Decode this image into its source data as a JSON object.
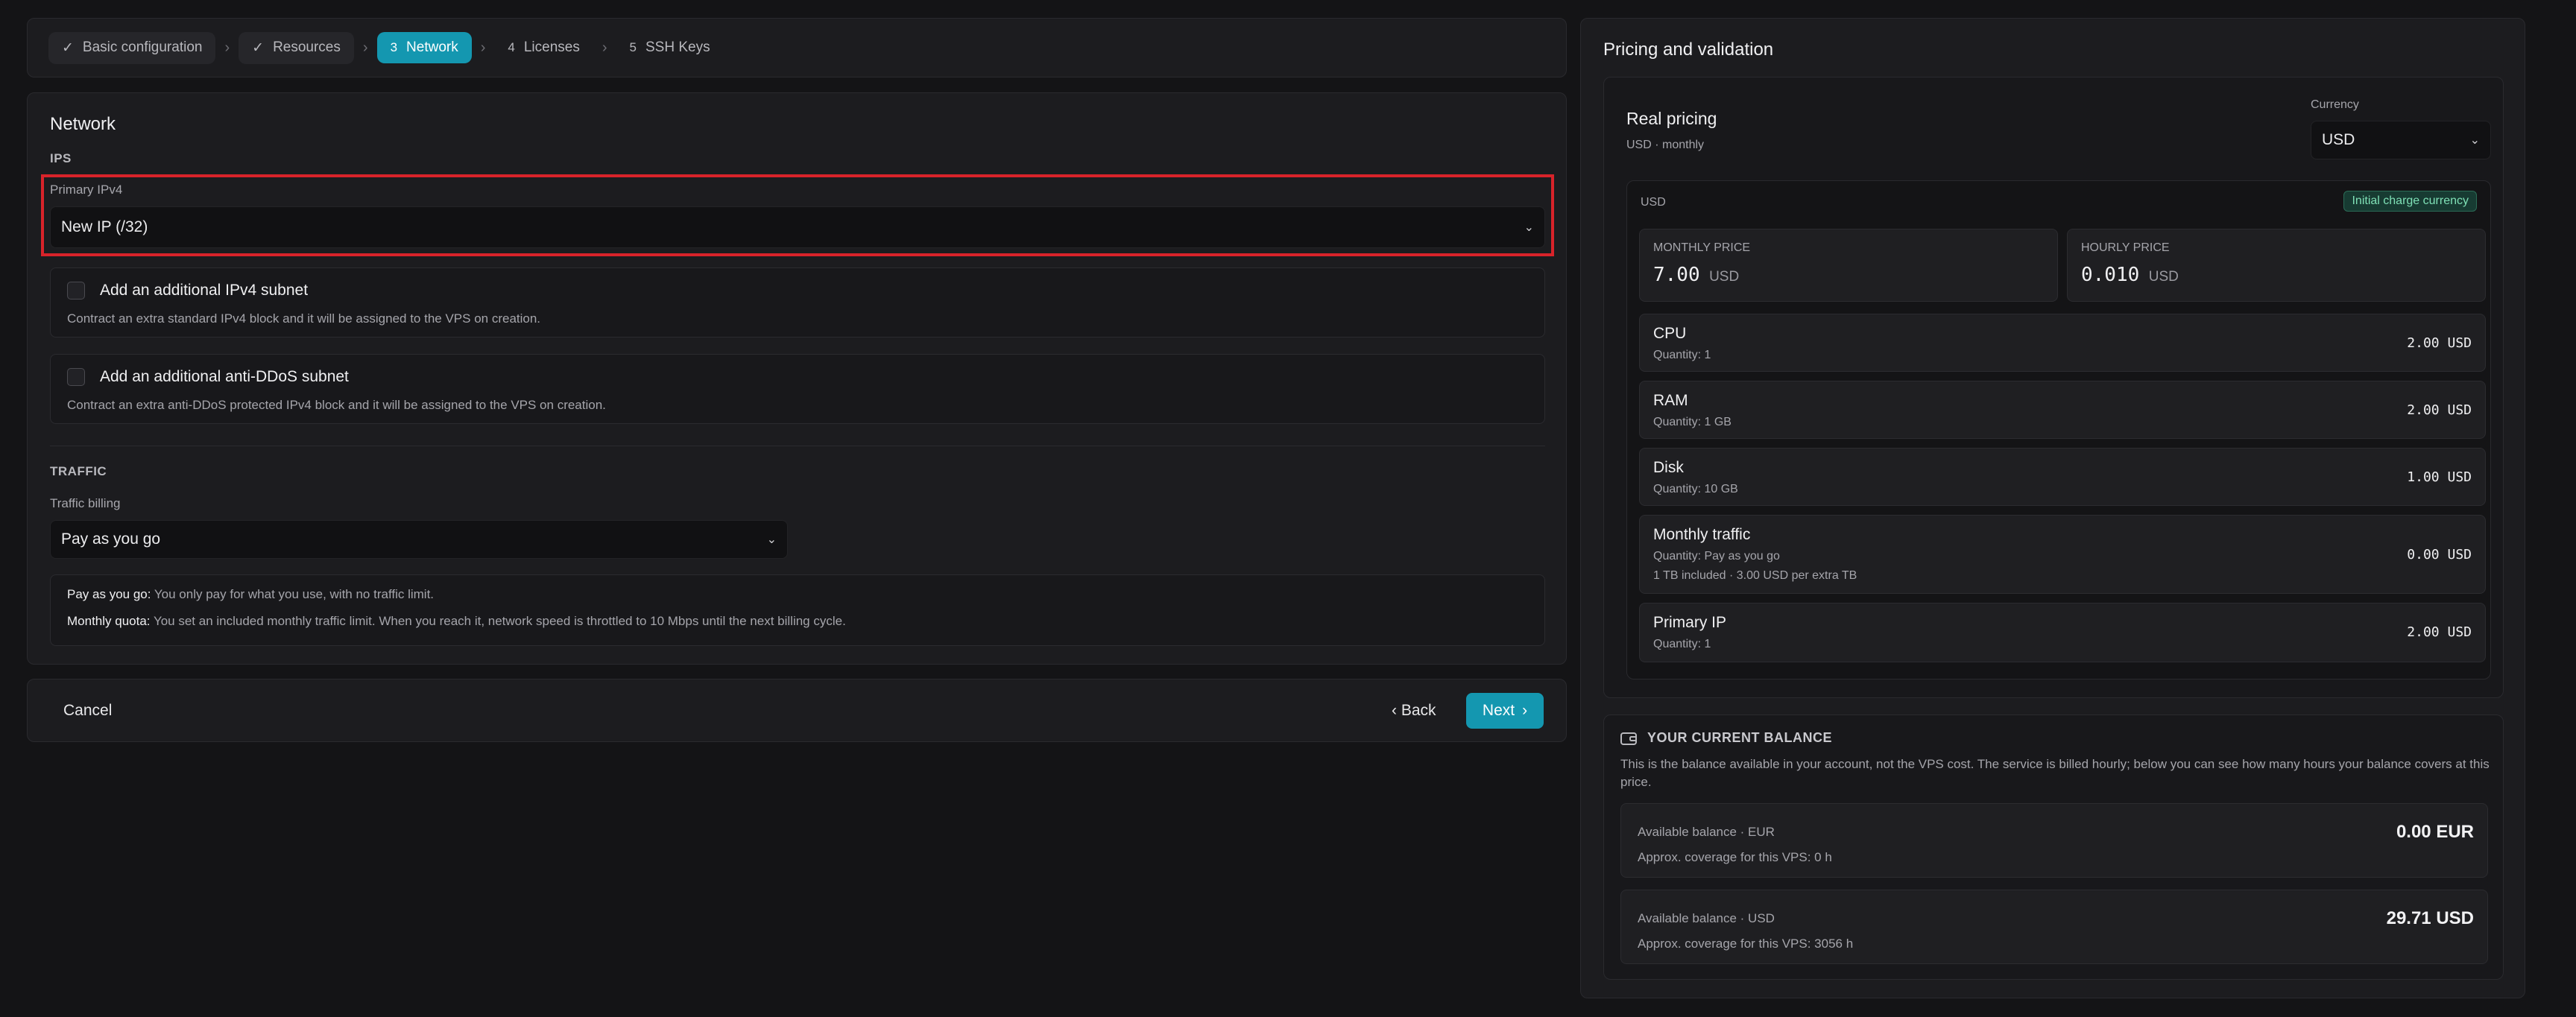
{
  "stepper": {
    "steps": [
      {
        "label": "Basic configuration",
        "state": "done",
        "num": ""
      },
      {
        "label": "Resources",
        "state": "done",
        "num": ""
      },
      {
        "label": "Network",
        "state": "active",
        "num": "3"
      },
      {
        "label": "Licenses",
        "state": "pending",
        "num": "4"
      },
      {
        "label": "SSH Keys",
        "state": "pending",
        "num": "5"
      }
    ],
    "check_icon": "✓",
    "sep_icon": "›"
  },
  "network": {
    "title": "Network",
    "ips_heading": "IPS",
    "primary_ipv4_label": "Primary IPv4",
    "primary_ipv4_value": "New IP (/32)",
    "options": [
      {
        "title": "Add an additional IPv4 subnet",
        "desc": "Contract an extra standard IPv4 block and it will be assigned to the VPS on creation."
      },
      {
        "title": "Add an additional anti-DDoS subnet",
        "desc": "Contract an extra anti-DDoS protected IPv4 block and it will be assigned to the VPS on creation."
      }
    ],
    "traffic_heading": "TRAFFIC",
    "traffic_billing_label": "Traffic billing",
    "traffic_billing_value": "Pay as you go",
    "info": [
      {
        "term": "Pay as you go:",
        "text": "You only pay for what you use, with no traffic limit."
      },
      {
        "term": "Monthly quota:",
        "text": "You set an included monthly traffic limit. When you reach it, network speed is throttled to 10 Mbps until the next billing cycle."
      }
    ]
  },
  "footer": {
    "cancel": "Cancel",
    "back": "Back",
    "next": "Next"
  },
  "pricing": {
    "title": "Pricing and validation",
    "real_pricing": "Real pricing",
    "subtitle": "USD · monthly",
    "currency_label": "Currency",
    "currency_value": "USD",
    "box_currency": "USD",
    "badge": "Initial charge currency",
    "monthly_label": "MONTHLY PRICE",
    "monthly_value": "7.00",
    "monthly_unit": "USD",
    "hourly_label": "HOURLY PRICE",
    "hourly_value": "0.010",
    "hourly_unit": "USD",
    "items": [
      {
        "title": "CPU",
        "sub": "Quantity: 1",
        "sub2": "",
        "price": "2.00 USD"
      },
      {
        "title": "RAM",
        "sub": "Quantity: 1 GB",
        "sub2": "",
        "price": "2.00 USD"
      },
      {
        "title": "Disk",
        "sub": "Quantity: 10 GB",
        "sub2": "",
        "price": "1.00 USD"
      },
      {
        "title": "Monthly traffic",
        "sub": "Quantity: Pay as you go",
        "sub2": "1 TB included · 3.00 USD per extra TB",
        "price": "0.00 USD"
      },
      {
        "title": "Primary IP",
        "sub": "Quantity: 1",
        "sub2": "",
        "price": "2.00 USD"
      }
    ]
  },
  "balance": {
    "heading": "YOUR CURRENT BALANCE",
    "desc": "This is the balance available in your account, not the VPS cost. The service is billed hourly; below you can see how many hours your balance covers at this price.",
    "accounts": [
      {
        "label": "Available balance · EUR",
        "coverage": "Approx. coverage for this VPS: 0 h",
        "amount": "0.00 EUR"
      },
      {
        "label": "Available balance · USD",
        "coverage": "Approx. coverage for this VPS: 3056 h",
        "amount": "29.71 USD"
      }
    ]
  },
  "colors": {
    "accent": "#1497b0",
    "highlight": "#d8232a",
    "badge_bg": "#173b32",
    "badge_text": "#7fe0b6"
  }
}
